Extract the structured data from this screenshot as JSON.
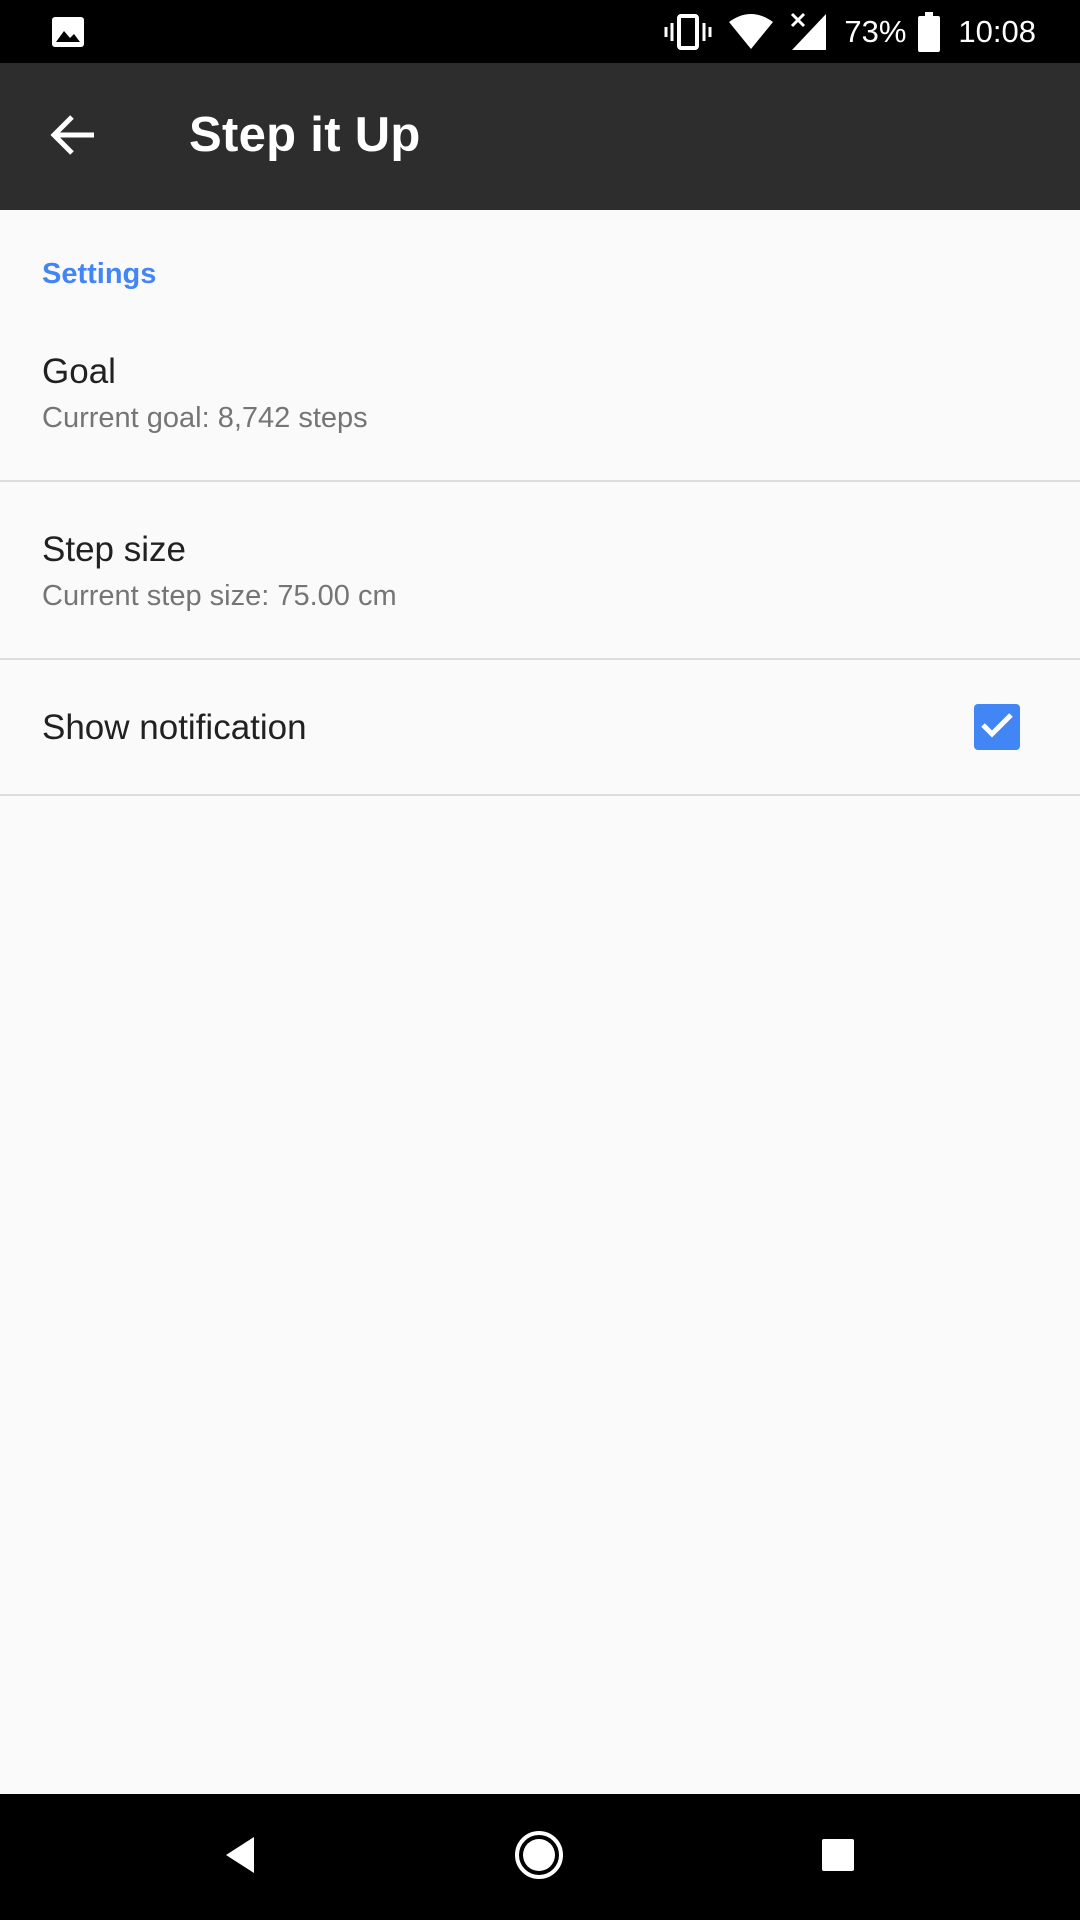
{
  "status_bar": {
    "battery_percent": "73%",
    "time": "10:08",
    "icons": [
      "gallery-icon",
      "vibrate-icon",
      "wifi-icon",
      "signal-icon",
      "battery-icon"
    ]
  },
  "app_bar": {
    "title": "Step it Up",
    "back_icon": "arrow-back-icon"
  },
  "settings": {
    "section_header": "Settings",
    "items": [
      {
        "title": "Goal",
        "summary": "Current goal: 8,742 steps"
      },
      {
        "title": "Step size",
        "summary": "Current step size: 75.00 cm"
      },
      {
        "title": "Show notification",
        "checked": true
      }
    ]
  },
  "nav_bar": {
    "buttons": [
      "back-triangle-icon",
      "home-circle-icon",
      "recents-square-icon"
    ]
  },
  "colors": {
    "accent": "#4285f4",
    "app_bar": "#2d2d2d",
    "background": "#fafafa"
  }
}
